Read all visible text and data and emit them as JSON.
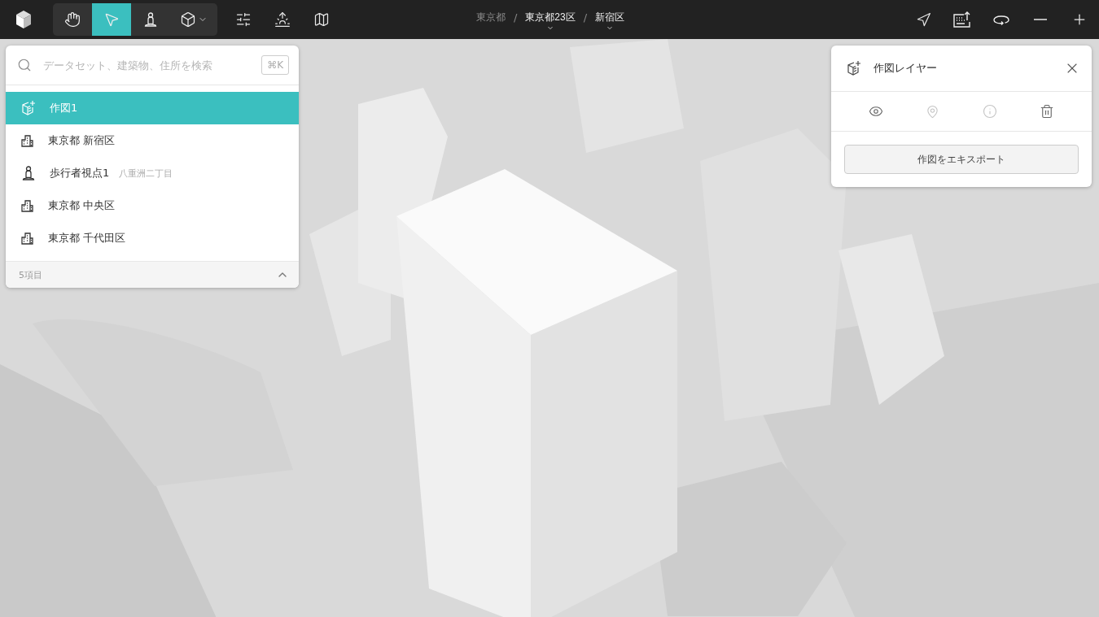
{
  "toolbar": {
    "tools": [
      {
        "kind": "hand",
        "selected": false,
        "dropdown": false
      },
      {
        "kind": "pointer",
        "selected": true,
        "dropdown": false
      },
      {
        "kind": "pedestrian",
        "selected": false,
        "dropdown": false
      },
      {
        "kind": "cube",
        "selected": false,
        "dropdown": true
      }
    ],
    "extras": [
      {
        "kind": "sliders"
      },
      {
        "kind": "sunrise"
      },
      {
        "kind": "map"
      }
    ]
  },
  "breadcrumbs": [
    {
      "label": "東京都",
      "dimmed": true,
      "expandable": false
    },
    {
      "separator": "/",
      "label": "東京都23区",
      "dimmed": false,
      "expandable": true
    },
    {
      "separator": "/",
      "label": "新宿区",
      "dimmed": false,
      "expandable": true
    }
  ],
  "view_controls": [
    {
      "kind": "navigate"
    },
    {
      "kind": "export"
    },
    {
      "kind": "orbit"
    },
    {
      "kind": "zoom-out"
    },
    {
      "kind": "zoom-in"
    }
  ],
  "layers_panel": {
    "search": {
      "placeholder": "データセット、建築物、住所を検索",
      "shortcut": "⌘K"
    },
    "items": [
      {
        "kind": "drawing",
        "label": "作図1",
        "selected": true
      },
      {
        "kind": "area",
        "label": "東京都 新宿区",
        "selected": false
      },
      {
        "kind": "pedestrian",
        "label": "歩行者視点1",
        "sublabel": "八重洲二丁目",
        "selected": false
      },
      {
        "kind": "area",
        "label": "東京都 中央区",
        "selected": false
      },
      {
        "kind": "area",
        "label": "東京都 千代田区",
        "selected": false
      }
    ],
    "footer": {
      "count": "5項目",
      "expanded": true
    }
  },
  "inspector": {
    "title": "作図レイヤー",
    "actions": [
      {
        "kind": "visibility",
        "disabled": false
      },
      {
        "kind": "locate",
        "disabled": true
      },
      {
        "kind": "info",
        "disabled": true
      },
      {
        "kind": "delete",
        "disabled": false
      }
    ],
    "button": "作図をエキスポート"
  }
}
